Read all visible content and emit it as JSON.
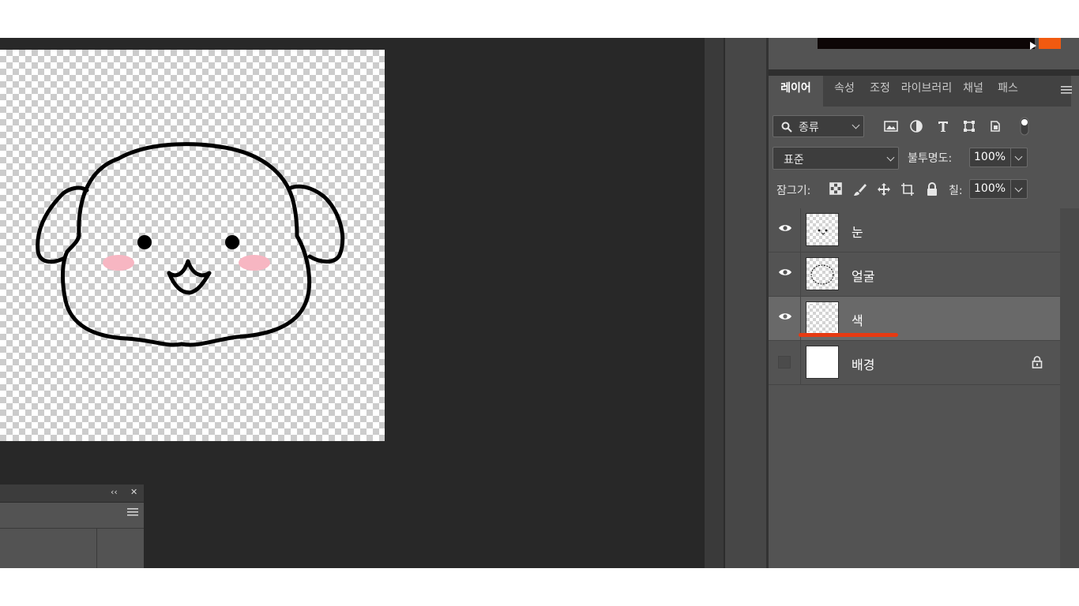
{
  "layers_panel": {
    "tabs": [
      {
        "label": "레이어",
        "active": true
      },
      {
        "label": "속성"
      },
      {
        "label": "조정"
      },
      {
        "label": "라이브러리"
      },
      {
        "label": "채널"
      },
      {
        "label": "패스"
      }
    ],
    "filter_kind": "종류",
    "blend_mode": "표준",
    "opacity_label": "불투명도:",
    "opacity_value": "100%",
    "lock_label": "잠그기:",
    "fill_label": "칠:",
    "fill_value": "100%",
    "layers": [
      {
        "name": "눈",
        "visible": true,
        "selected": false,
        "thumbnail": "eyes-thumbnail"
      },
      {
        "name": "얼굴",
        "visible": true,
        "selected": false,
        "thumbnail": "face-outline-thumbnail"
      },
      {
        "name": "색",
        "visible": true,
        "selected": true,
        "thumbnail": "transparent-thumbnail"
      },
      {
        "name": "배경",
        "visible": false,
        "selected": false,
        "locked": true,
        "thumbnail": "white-thumbnail"
      }
    ]
  },
  "annotation": {
    "underline_color": "#e63a12",
    "target_layer": "색"
  },
  "colors": {
    "workspace": "#282828",
    "panel": "#535353",
    "selected_row": "#696969",
    "accent_orange": "#f15a10"
  }
}
